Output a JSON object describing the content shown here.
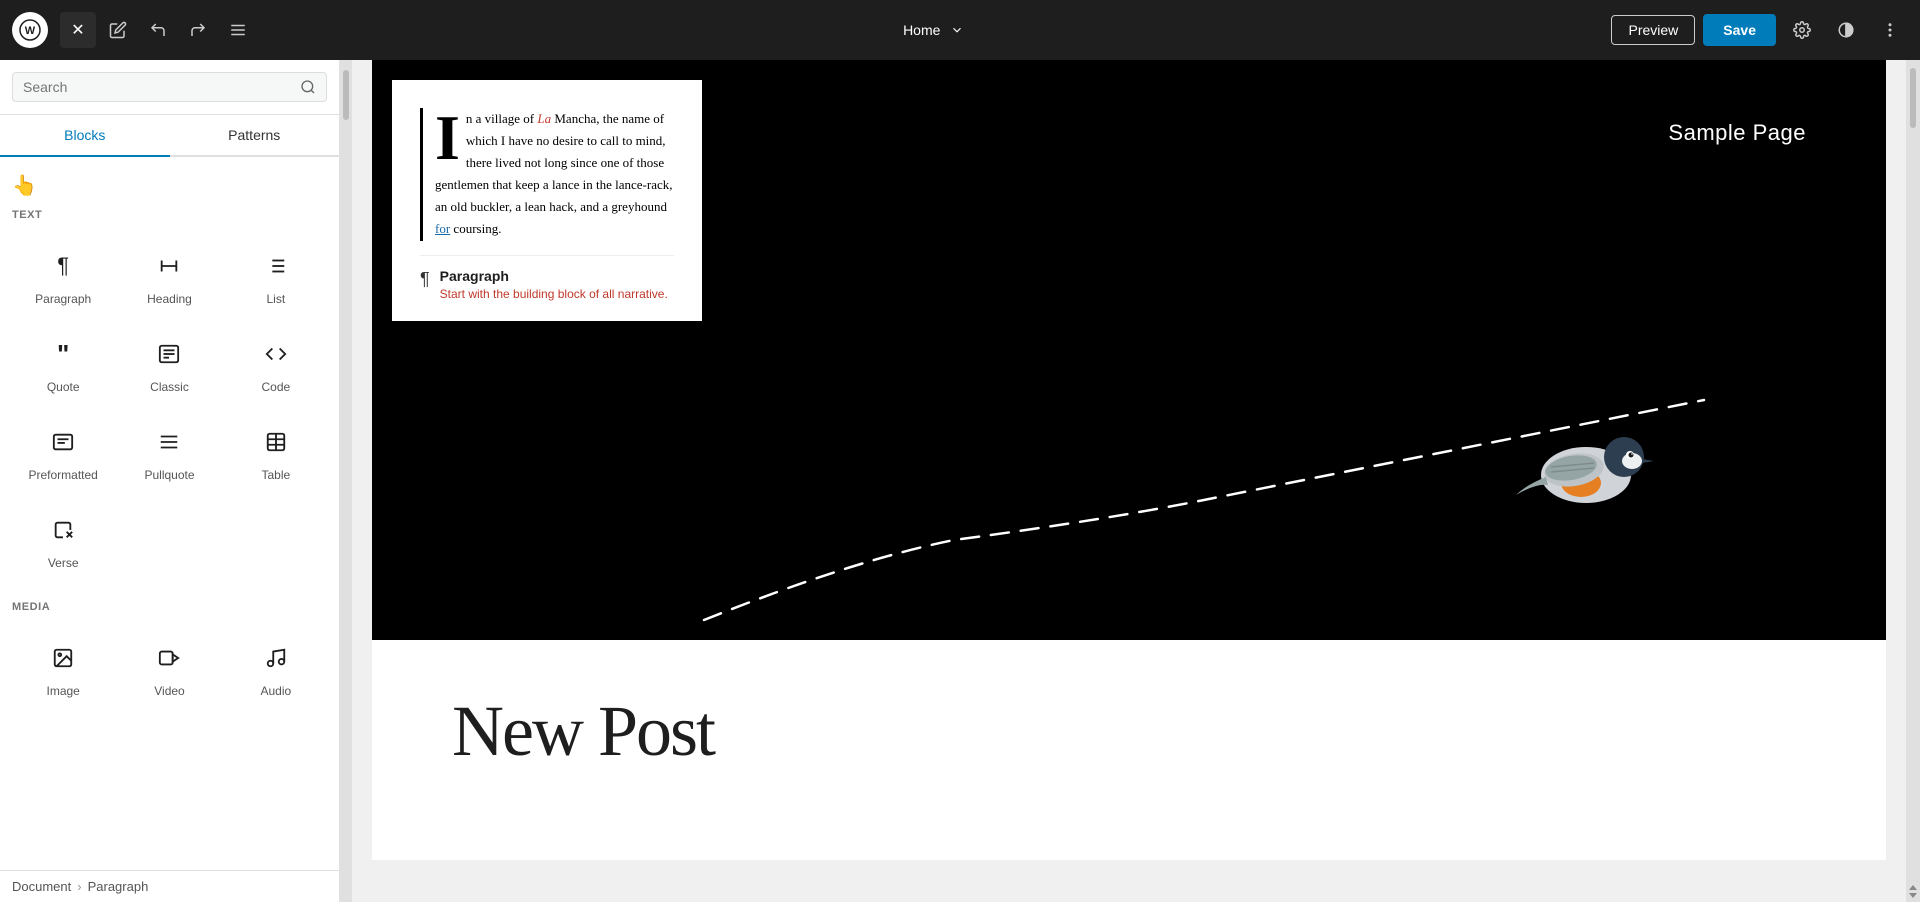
{
  "topbar": {
    "close_label": "×",
    "undo_label": "↩",
    "redo_label": "↪",
    "list_view_label": "≡",
    "home_label": "Home",
    "preview_label": "Preview",
    "save_label": "Save"
  },
  "sidebar": {
    "search_placeholder": "Search",
    "tab_blocks": "Blocks",
    "tab_patterns": "Patterns",
    "section_text": "TEXT",
    "section_media": "MEDIA",
    "blocks": [
      {
        "id": "paragraph",
        "icon": "¶",
        "label": "Paragraph"
      },
      {
        "id": "heading",
        "icon": "🔖",
        "label": "Heading"
      },
      {
        "id": "list",
        "icon": "≡",
        "label": "List"
      },
      {
        "id": "quote",
        "icon": "❝",
        "label": "Quote"
      },
      {
        "id": "classic",
        "icon": "⌨",
        "label": "Classic"
      },
      {
        "id": "code",
        "icon": "<>",
        "label": "Code"
      },
      {
        "id": "preformatted",
        "icon": "▣",
        "label": "Preformatted"
      },
      {
        "id": "pullquote",
        "icon": "▬",
        "label": "Pullquote"
      },
      {
        "id": "table",
        "icon": "⊞",
        "label": "Table"
      },
      {
        "id": "verse",
        "icon": "✒",
        "label": "Verse"
      }
    ],
    "media_blocks": [
      {
        "id": "image",
        "icon": "🖼",
        "label": "Image"
      },
      {
        "id": "video",
        "icon": "🎬",
        "label": "Video"
      },
      {
        "id": "audio",
        "icon": "♪",
        "label": "Audio"
      }
    ]
  },
  "breadcrumb": {
    "document": "Document",
    "separator": "›",
    "paragraph": "Paragraph"
  },
  "canvas": {
    "sample_page": "Sample Page",
    "body_text": "n a village of La Mancha, the name of which I have no desire to call to mind, there lived not long since one of those gentlemen that keep a lance in the lance-rack, an old buckler, a lean hack, and a greyhound for coursing.",
    "tooltip_title": "Paragraph",
    "tooltip_desc": "Start with the building block of all narrative.",
    "new_post_title": "New Post"
  },
  "colors": {
    "accent": "#007cba",
    "topbar_bg": "#1e1e1e",
    "canvas_bg": "#000000",
    "white": "#ffffff",
    "red_highlight": "#c0392b",
    "blue_link": "#1a6aaa"
  }
}
